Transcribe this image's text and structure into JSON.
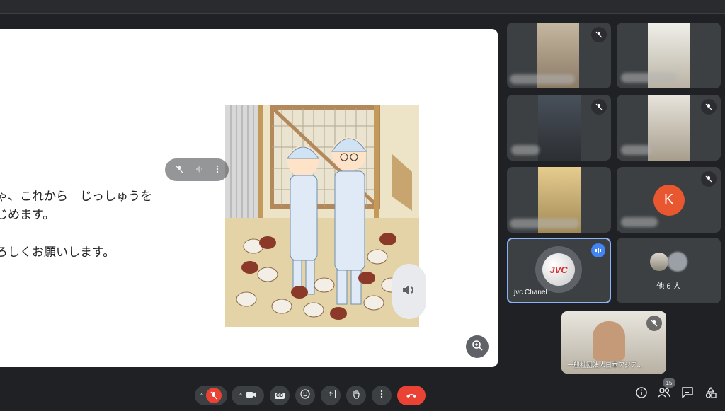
{
  "slide": {
    "line1": "ゃ、これから　じっしゅうを",
    "line2": "じめます。",
    "line3": "ろしくお願いします。"
  },
  "participants": [
    {
      "id": "p1",
      "muted": true
    },
    {
      "id": "p2",
      "muted": false
    },
    {
      "id": "p3",
      "muted": true
    },
    {
      "id": "p4",
      "muted": true
    },
    {
      "id": "p5",
      "muted": false
    },
    {
      "id": "p6",
      "avatar_letter": "K",
      "avatar_color": "#e8572f",
      "muted": true
    },
    {
      "id": "p7",
      "name": "jvc Chanel",
      "speaking": true,
      "logo_text": "JVC"
    },
    {
      "id": "p8",
      "others_label": "他 6 人"
    },
    {
      "id": "p9",
      "name": "一般社団法人日本アジア...",
      "muted": true
    }
  ],
  "toolbar": {
    "participants_count": "15",
    "caption_icon_text": "CC"
  },
  "colors": {
    "background": "#202124",
    "tile": "#3c4043",
    "end_call": "#ea4335",
    "active_border": "#8ab4f8",
    "speaking_badge": "#4285f4"
  },
  "icons": [
    "mic-off-icon",
    "camera-icon",
    "captions-icon",
    "emoji-icon",
    "present-icon",
    "hand-icon",
    "more-icon",
    "hangup-icon",
    "info-icon",
    "people-icon",
    "chat-icon",
    "activities-icon",
    "speaker-icon",
    "zoom-icon"
  ]
}
